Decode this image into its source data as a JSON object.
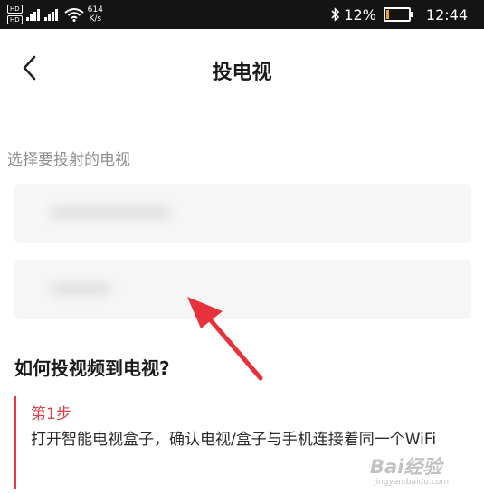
{
  "status_bar": {
    "hd1": "HD",
    "hd2": "HD",
    "net1": "4G",
    "net2": "4G",
    "speed_value": "614",
    "speed_unit": "K/s",
    "bluetooth_icon": "bluetooth-icon",
    "battery_percent": "12%",
    "battery_level": 0.12,
    "time": "12:44"
  },
  "nav": {
    "back_icon": "chevron-left-icon",
    "title": "投电视"
  },
  "device_list": {
    "label": "选择要投射的电视",
    "items": [
      {
        "name": "••••••••••••••"
      },
      {
        "name": "•••••••"
      }
    ]
  },
  "howto": {
    "title": "如何投视频到电视?",
    "step_label": "第1步",
    "step_text": "打开智能电视盒子，确认电视/盒子与手机连接着同一个WiFi"
  },
  "watermark": {
    "text": "Bai经验",
    "sub": "jingyan.baidu.com"
  },
  "colors": {
    "accent": "#e4373f",
    "status_bar_bg": "#141414",
    "item_bg": "#f6f6f7",
    "annotation_arrow": "#e8323b"
  }
}
